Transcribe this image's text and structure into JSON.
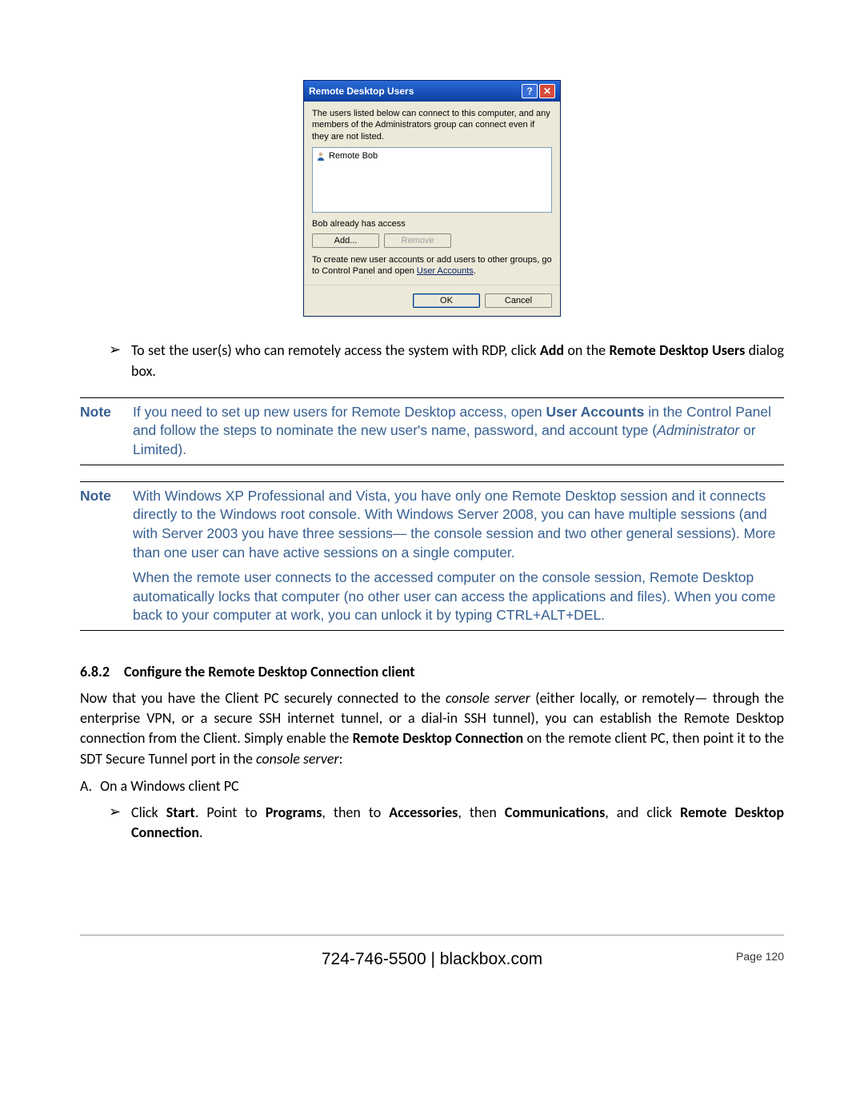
{
  "dialog": {
    "title": "Remote Desktop Users",
    "help_glyph": "?",
    "close_glyph": "✕",
    "description": "The users listed below can connect to this computer, and any members of the Administrators group can connect even if they are not listed.",
    "list_user": "Remote Bob",
    "status_text": "Bob already has access",
    "add_label": "Add...",
    "remove_label": "Remove",
    "create_note_1": "To create new user accounts or add users to other groups, go to Control Panel and open ",
    "create_note_link": "User Accounts",
    "create_note_2": ".",
    "ok_label": "OK",
    "cancel_label": "Cancel"
  },
  "bullet1": {
    "pre": "To set the user(s) who can remotely access the system with RDP, click ",
    "bold1": "Add",
    "mid": " on the ",
    "bold2": "Remote Desktop Users",
    "post": " dialog box."
  },
  "note1": {
    "label": "Note",
    "t1": "If you need to set up new users for Remote Desktop access, open ",
    "b1": "User Accounts",
    "t2": " in the Control Panel and follow the steps to nominate the new user's name, password, and account type (",
    "i1": "Administrator",
    "t3": " or Limited)."
  },
  "note2": {
    "label": "Note",
    "p1": "With Windows XP Professional and Vista, you have only one Remote Desktop session and it connects directly to the Windows root console. With Windows Server 2008, you can have multiple sessions (and with Server 2003 you have three sessions— the console session and two other general sessions). More than one user can have active sessions on a single computer.",
    "p2": "When the remote user connects to the accessed computer on the console session, Remote Desktop automatically locks that computer (no other user can access the applications and files). When you come back to your computer at work, you can unlock it by typing CTRL+ALT+DEL."
  },
  "heading": {
    "number": "6.8.2",
    "text": "Configure the Remote Desktop Connection client"
  },
  "para": {
    "t1": "Now that you have the Client PC securely connected to the ",
    "i1": "console server",
    "t2": " (either locally, or remotely— through the enterprise VPN, or a secure SSH internet tunnel, or a dial-in SSH tunnel), you can establish the Remote Desktop connection from the Client. Simply enable the ",
    "b1": "Remote Desktop Connection",
    "t3": " on the remote client PC, then point it to the SDT Secure Tunnel port in the ",
    "i2": "console server",
    "t4": ":"
  },
  "listA": {
    "letter": "A.",
    "text": "On a Windows client PC"
  },
  "bullet2": {
    "t1": "Click ",
    "b1": "Start",
    "t2": ". Point to ",
    "b2": "Programs",
    "t3": ", then to ",
    "b3": "Accessories",
    "t4": ", then ",
    "b4": "Communications",
    "t5": ", and click ",
    "b5": "Remote Desktop Connection",
    "t6": "."
  },
  "footer": {
    "center": "724-746-5500 | blackbox.com",
    "page": "Page 120"
  }
}
